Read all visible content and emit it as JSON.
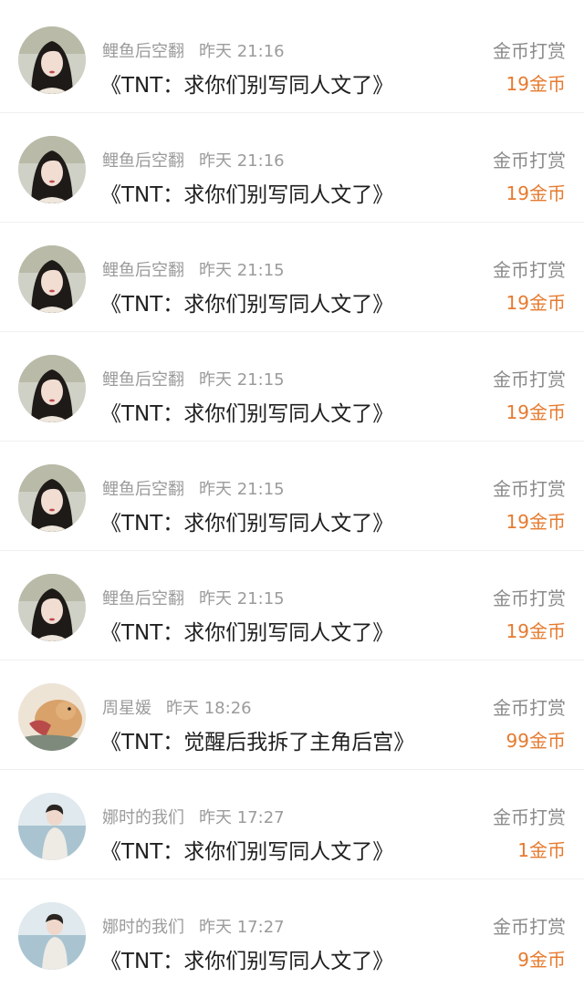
{
  "rows": [
    {
      "name": "鲤鱼后空翻",
      "time": "昨天 21:16",
      "title": "《TNT：求你们别写同人文了》",
      "action": "金币打赏",
      "amount": "19金币",
      "avatar_icon": "woman-dark-hair-avatar"
    },
    {
      "name": "鲤鱼后空翻",
      "time": "昨天 21:16",
      "title": "《TNT：求你们别写同人文了》",
      "action": "金币打赏",
      "amount": "19金币",
      "avatar_icon": "woman-dark-hair-avatar"
    },
    {
      "name": "鲤鱼后空翻",
      "time": "昨天 21:15",
      "title": "《TNT：求你们别写同人文了》",
      "action": "金币打赏",
      "amount": "19金币",
      "avatar_icon": "woman-dark-hair-avatar"
    },
    {
      "name": "鲤鱼后空翻",
      "time": "昨天 21:15",
      "title": "《TNT：求你们别写同人文了》",
      "action": "金币打赏",
      "amount": "19金币",
      "avatar_icon": "woman-dark-hair-avatar"
    },
    {
      "name": "鲤鱼后空翻",
      "time": "昨天 21:15",
      "title": "《TNT：求你们别写同人文了》",
      "action": "金币打赏",
      "amount": "19金币",
      "avatar_icon": "woman-dark-hair-avatar"
    },
    {
      "name": "鲤鱼后空翻",
      "time": "昨天 21:15",
      "title": "《TNT：求你们别写同人文了》",
      "action": "金币打赏",
      "amount": "19金币",
      "avatar_icon": "woman-dark-hair-avatar"
    },
    {
      "name": "周星媛",
      "time": "昨天 18:26",
      "title": "《TNT：觉醒后我拆了主角后宫》",
      "action": "金币打赏",
      "amount": "99金币",
      "avatar_icon": "cat-avatar"
    },
    {
      "name": "娜时的我们",
      "time": "昨天 17:27",
      "title": "《TNT：求你们别写同人文了》",
      "action": "金币打赏",
      "amount": "1金币",
      "avatar_icon": "person-by-sea-avatar"
    },
    {
      "name": "娜时的我们",
      "time": "昨天 17:27",
      "title": "《TNT：求你们别写同人文了》",
      "action": "金币打赏",
      "amount": "9金币",
      "avatar_icon": "person-by-sea-avatar"
    }
  ],
  "colors": {
    "meta_text": "#9b9b9b",
    "title_text": "#1f1f1f",
    "action_text": "#8a8a8a",
    "amount_accent": "#e67a2e",
    "divider": "#f0f0f0"
  }
}
